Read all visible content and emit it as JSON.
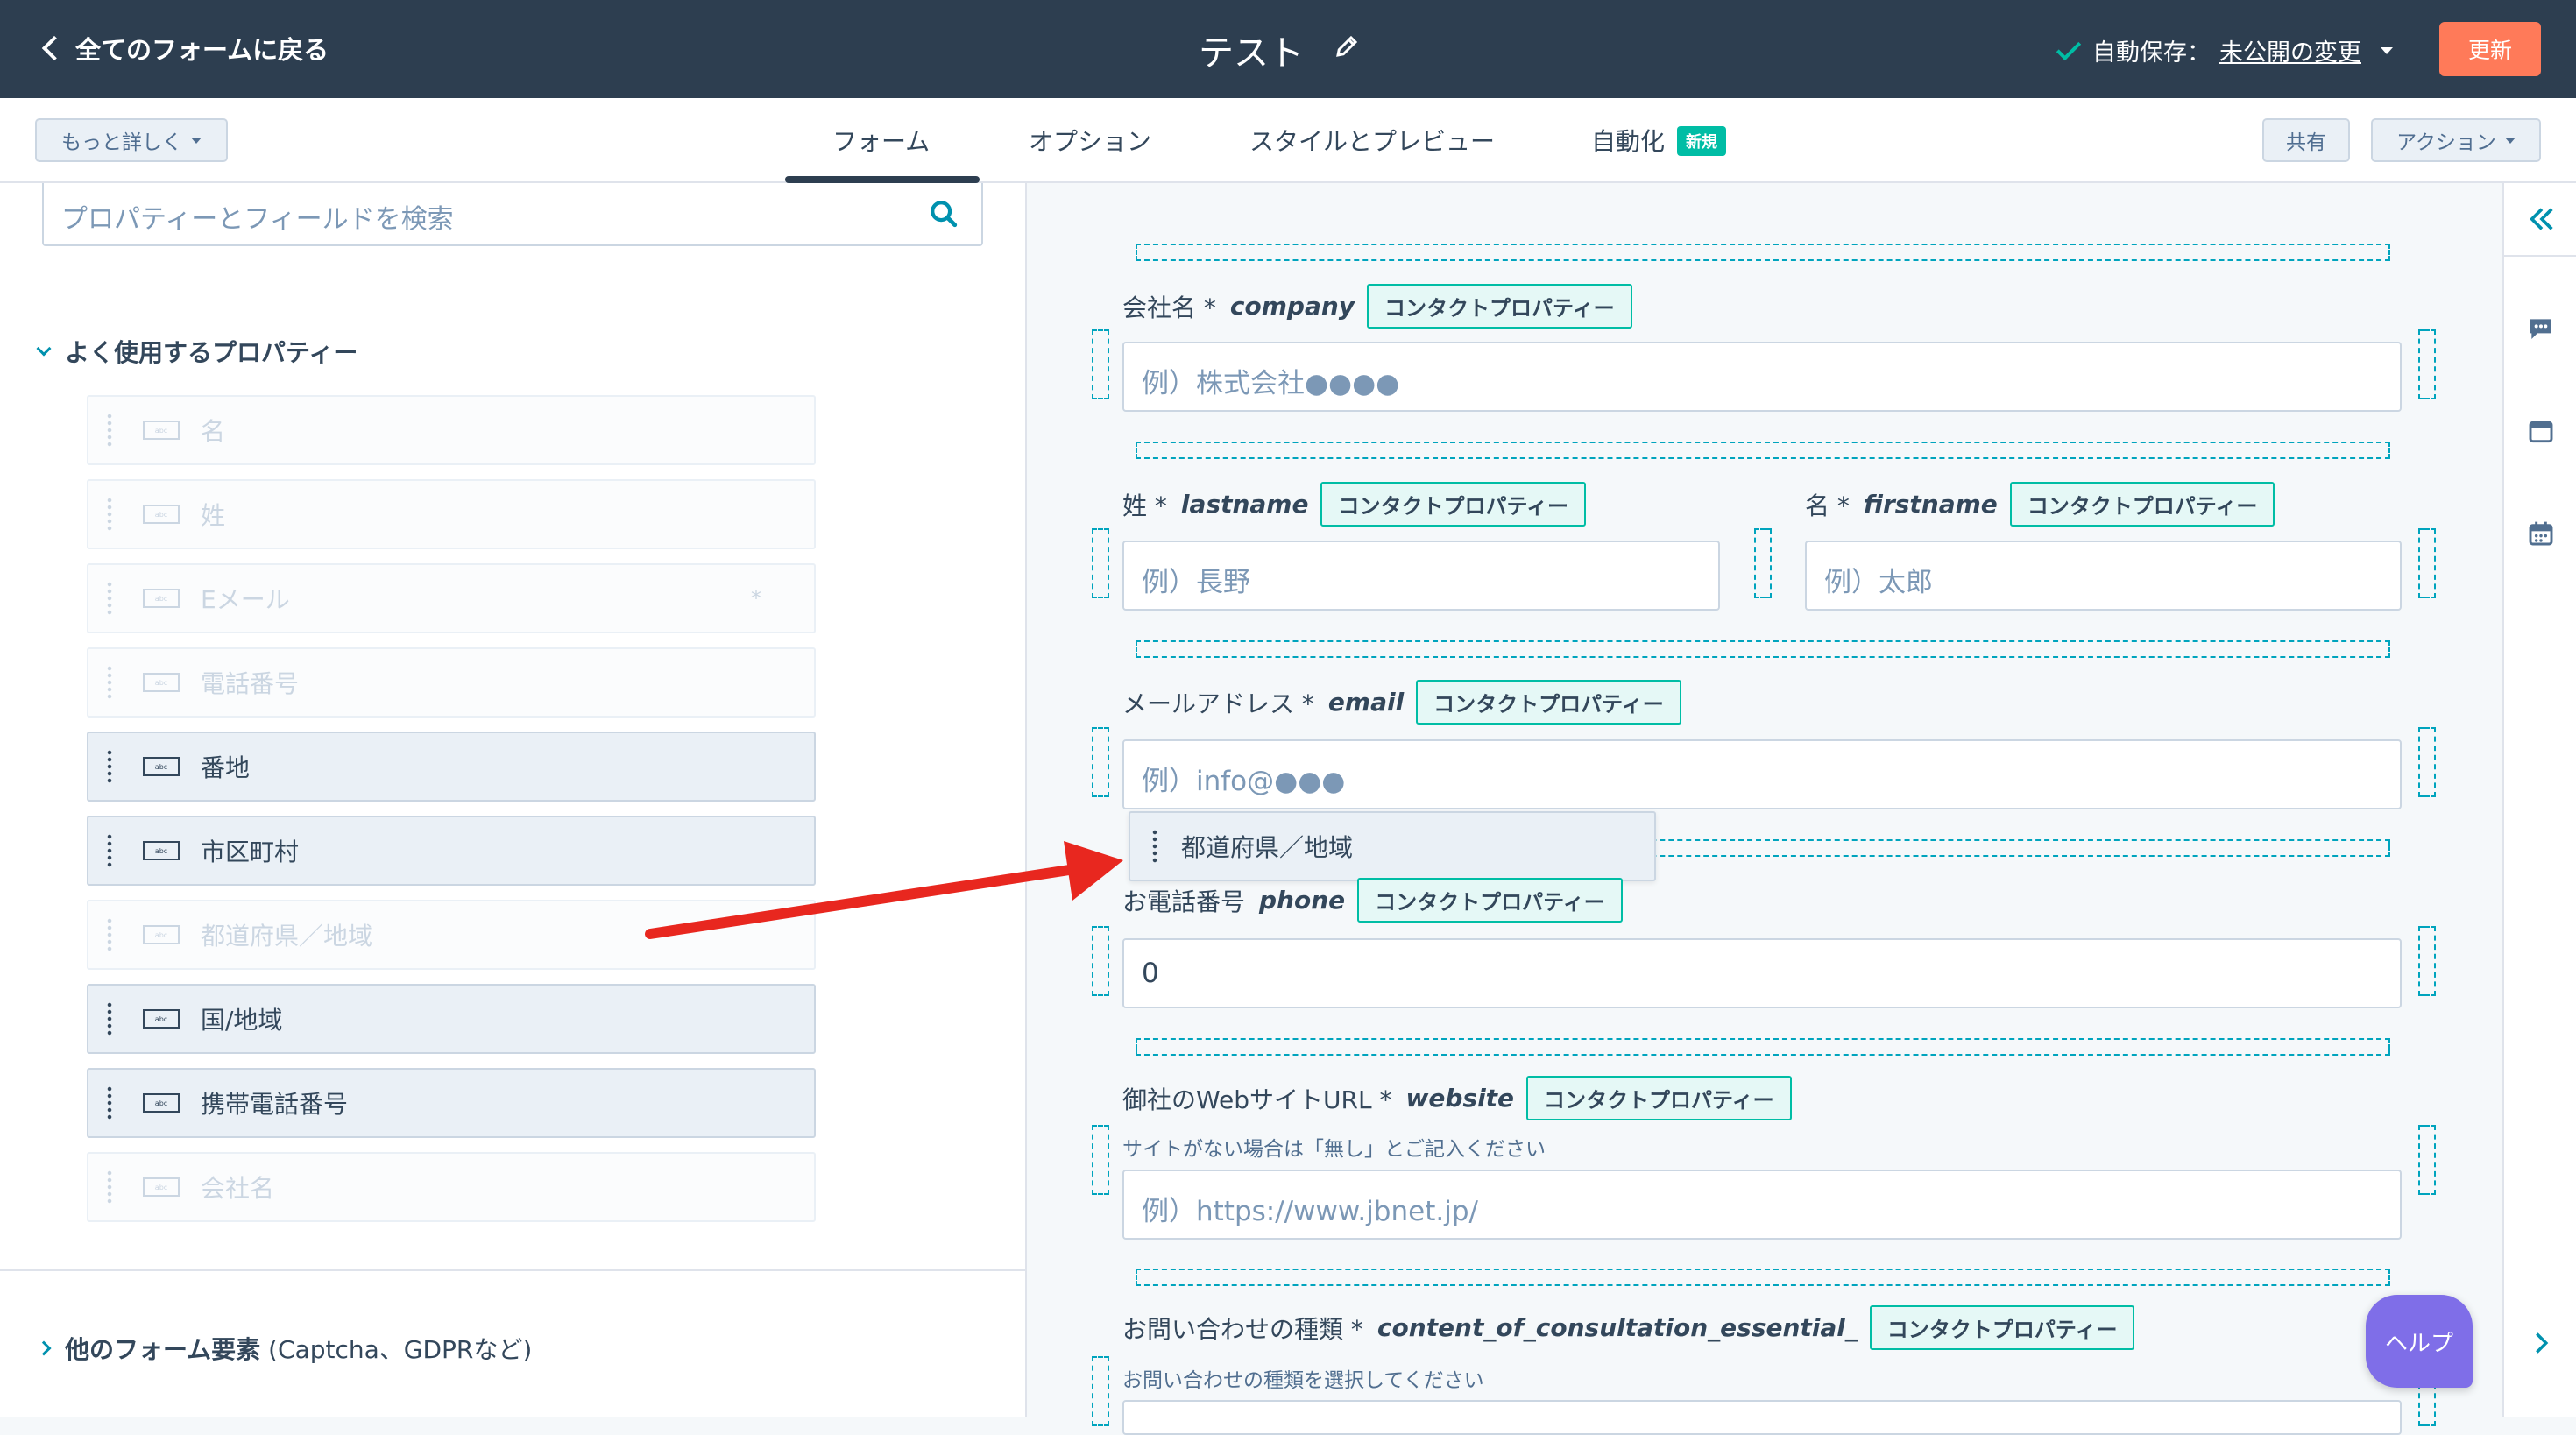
{
  "topbar": {
    "back_label": "全てのフォームに戻る",
    "title": "テスト",
    "autosave_prefix": "自動保存：",
    "autosave_link": "未公開の変更",
    "update_label": "更新"
  },
  "subnav": {
    "more_details": "もっと詳しく",
    "tabs": [
      {
        "label": "フォーム",
        "active": true
      },
      {
        "label": "オプション"
      },
      {
        "label": "スタイルとプレビュー"
      },
      {
        "label": "自動化",
        "badge": "新規"
      }
    ],
    "share": "共有",
    "actions": "アクション"
  },
  "sidebar": {
    "search_placeholder": "プロパティーとフィールドを検索",
    "section_title": "よく使用するプロパティー",
    "properties": [
      {
        "label": "名",
        "active": false
      },
      {
        "label": "姓",
        "active": false
      },
      {
        "label": "Eメール",
        "active": false,
        "required": "*"
      },
      {
        "label": "電話番号",
        "active": false
      },
      {
        "label": "番地",
        "active": true
      },
      {
        "label": "市区町村",
        "active": true
      },
      {
        "label": "都道府県／地域",
        "active": false
      },
      {
        "label": "国/地域",
        "active": true
      },
      {
        "label": "携帯電話番号",
        "active": true
      },
      {
        "label": "会社名",
        "active": false
      }
    ],
    "field_icon_text": "abc",
    "other_section_bold": "他のフォーム要素",
    "other_section_rest": " (Captcha、GDPRなど)"
  },
  "form": {
    "tag": "コンタクトプロパティー",
    "fields": {
      "company": {
        "label": "会社名 *",
        "name": "company",
        "placeholder": "例）株式会社●●●●"
      },
      "lastname": {
        "label": "姓 *",
        "name": "lastname",
        "placeholder": "例）長野"
      },
      "firstname": {
        "label": "名 *",
        "name": "firstname",
        "placeholder": "例）太郎"
      },
      "email": {
        "label": "メールアドレス *",
        "name": "email",
        "placeholder": "例）info@●●●"
      },
      "phone": {
        "label": "お電話番号",
        "name": "phone",
        "value": "0"
      },
      "website": {
        "label": "御社のWebサイトURL *",
        "name": "website",
        "help": "サイトがない場合は「無し」とご記入ください",
        "placeholder": "例）https://www.jbnet.jp/"
      },
      "consultation": {
        "label": "お問い合わせの種類 *",
        "name": "content_of_consultation_essential_",
        "help": "お問い合わせの種類を選択してください"
      }
    },
    "dragging_label": "都道府県／地域"
  },
  "help_label": "ヘルプ",
  "colors": {
    "topbar": "#2d3e50",
    "accent": "#ff7a59",
    "teal": "#00bda5",
    "arrow": "#e8271f",
    "help": "#7f6ee8"
  }
}
